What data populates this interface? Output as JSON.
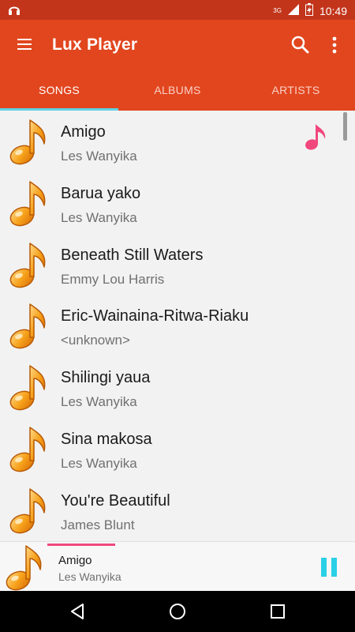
{
  "status_bar": {
    "time": "10:49",
    "network": "3G",
    "icons": [
      "headphones-icon",
      "signal-icon",
      "battery-icon"
    ]
  },
  "app_bar": {
    "title": "Lux Player",
    "icons": [
      "menu-icon",
      "search-icon",
      "more-vert-icon"
    ],
    "color": "#e2461e"
  },
  "tabs": [
    {
      "label": "SONGS",
      "active": true
    },
    {
      "label": "ALBUMS",
      "active": false
    },
    {
      "label": "ARTISTS",
      "active": false
    }
  ],
  "songs": [
    {
      "title": "Amigo",
      "artist": "Les Wanyika",
      "playing": true
    },
    {
      "title": "Barua yako",
      "artist": "Les Wanyika"
    },
    {
      "title": "Beneath Still Waters",
      "artist": "Emmy Lou Harris"
    },
    {
      "title": "Eric-Wainaina-Ritwa-Riaku",
      "artist": "<unknown>"
    },
    {
      "title": "Shilingi yaua",
      "artist": "Les Wanyika"
    },
    {
      "title": "Sina makosa",
      "artist": "Les Wanyika"
    },
    {
      "title": "You're Beautiful",
      "artist": "James Blunt"
    }
  ],
  "now_playing": {
    "title": "Amigo",
    "artist": "Les Wanyika",
    "progress_fraction": 0.1,
    "control": "pause-icon",
    "accent": "#2ad0e6"
  },
  "nav_bar": {
    "icons": [
      "back-icon",
      "home-icon",
      "recents-icon"
    ]
  }
}
